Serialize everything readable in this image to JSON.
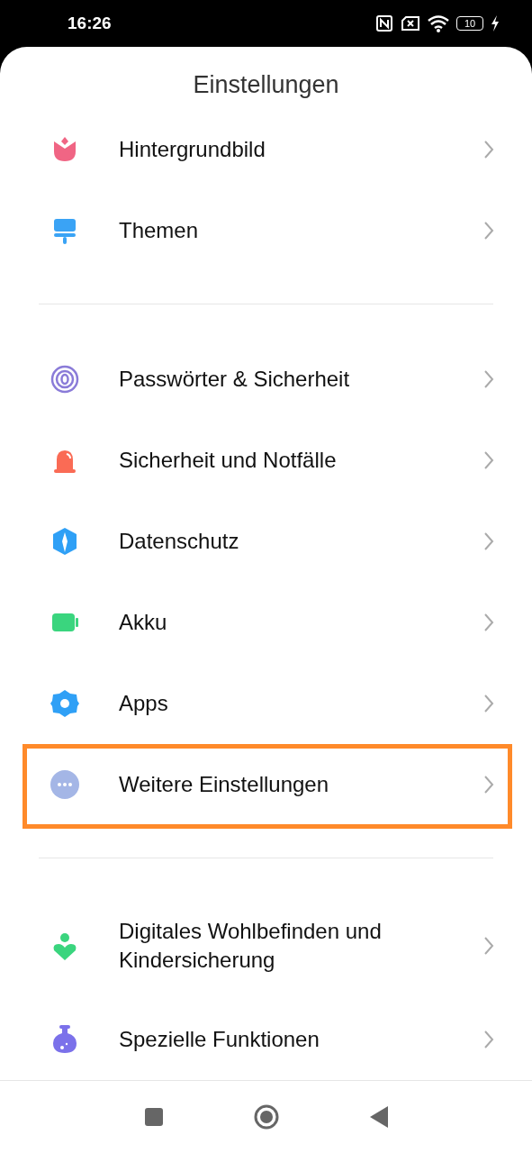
{
  "status_bar": {
    "time": "16:26",
    "battery": "10"
  },
  "title": "Einstellungen",
  "groups": [
    {
      "items": [
        {
          "label": "Hintergrundbild",
          "highlighted": false
        },
        {
          "label": "Themen",
          "highlighted": false
        }
      ]
    },
    {
      "items": [
        {
          "label": "Passwörter & Sicherheit",
          "highlighted": false
        },
        {
          "label": "Sicherheit und Notfälle",
          "highlighted": false
        },
        {
          "label": "Datenschutz",
          "highlighted": false
        },
        {
          "label": "Akku",
          "highlighted": false
        },
        {
          "label": "Apps",
          "highlighted": false
        },
        {
          "label": "Weitere Einstellungen",
          "highlighted": true
        }
      ]
    },
    {
      "items": [
        {
          "label": "Digitales Wohlbefinden und Kindersicherung",
          "highlighted": false
        },
        {
          "label": "Spezielle Funktionen",
          "highlighted": false
        }
      ]
    }
  ]
}
